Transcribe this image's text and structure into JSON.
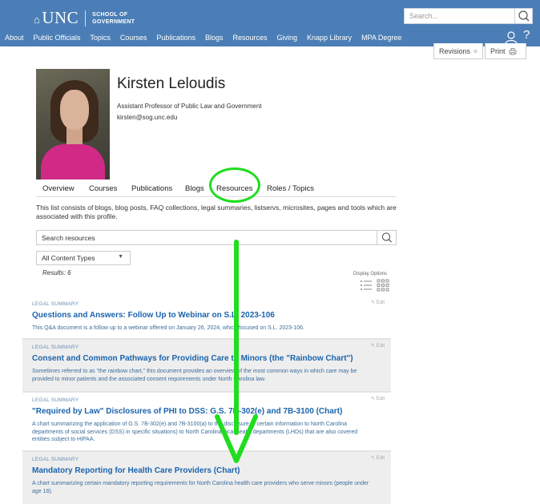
{
  "header": {
    "logo_main": "UNC",
    "logo_sub_1": "SCHOOL OF",
    "logo_sub_2": "GOVERNMENT",
    "search_placeholder": "Search...",
    "nav": [
      "About",
      "Public Officials",
      "Topics",
      "Courses",
      "Publications",
      "Blogs",
      "Resources",
      "Giving",
      "Knapp Library",
      "MPA Degree"
    ],
    "help": "?"
  },
  "toolbar": {
    "revisions": "Revisions",
    "print": "Print"
  },
  "profile": {
    "name": "Kirsten Leloudis",
    "title": "Assistant Professor of Public Law and Government",
    "email": "kirsten@sog.unc.edu"
  },
  "tabs": [
    "Overview",
    "Courses",
    "Publications",
    "Blogs",
    "Resources",
    "Roles / Topics"
  ],
  "intro": "This list consists of blogs, blog posts, FAQ collections, legal summaries, listservs, microsites, pages and tools which are associated with this profile.",
  "resources": {
    "search_placeholder": "Search resources",
    "filter_selected": "All Content Types",
    "results": "Results: 6",
    "display_options": "Display Options",
    "edit_label": "Edit",
    "items": [
      {
        "kind": "LEGAL SUMMARY",
        "title": "Questions and Answers: Follow Up to Webinar on S.L. 2023-106",
        "desc": "This Q&A document is a follow up to a webinar offered on January 26, 2024, which focused on S.L. 2023-106."
      },
      {
        "kind": "LEGAL SUMMARY",
        "title": "Consent and Common Pathways for Providing Care to Minors (the \"Rainbow Chart\")",
        "desc": "Sometimes referred to as \"the rainbow chart,\" this document provides an overview of the most common ways in which care may be provided to minor patients and the associated consent requirements under North Carolina law."
      },
      {
        "kind": "LEGAL SUMMARY",
        "title": "\"Required by Law\" Disclosures of PHI to DSS: G.S. 7B-302(e) and 7B-3100 (Chart)",
        "desc": "A chart summarizing the application of G.S. 7B-302(e) and 7B-3100(a) to the disclosure of certain information to North Carolina departments of social services (DSS) in specific situations) to North Carolina local health departments (LHDs) that are also covered entities subject to HIPAA."
      },
      {
        "kind": "LEGAL SUMMARY",
        "title": "Mandatory Reporting for Health Care Providers (Chart)",
        "desc": "A chart summarizing certain mandatory reporting requirements for North Carolina health care providers who serve minors (people under age 18)."
      }
    ]
  },
  "colors": {
    "header_bg": "#4b7eb6",
    "link": "#1b63ad",
    "annotation": "#1fdd1f"
  }
}
